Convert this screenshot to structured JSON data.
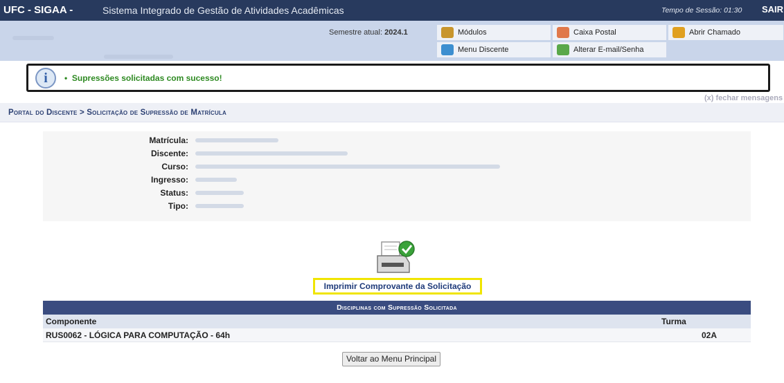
{
  "topbar": {
    "system": "UFC - SIGAA -",
    "system_name": "Sistema Integrado de Gestão de Atividades Acadêmicas",
    "session": "Tempo de Sessão: 01:30",
    "logout": "SAIR"
  },
  "header": {
    "semester_label": "Semestre atual:",
    "semester_value": "2024.1",
    "menu": [
      {
        "label": "Módulos",
        "icon": "modules-icon"
      },
      {
        "label": "Caixa Postal",
        "icon": "mailbox-icon"
      },
      {
        "label": "Abrir Chamado",
        "icon": "ticket-icon"
      },
      {
        "label": "Menu Discente",
        "icon": "student-menu-icon"
      },
      {
        "label": "Alterar E-mail/Senha",
        "icon": "change-password-icon"
      }
    ]
  },
  "message": {
    "bullet": "•",
    "text": "Supressões solicitadas com sucesso!",
    "close": "(x) fechar mensagens"
  },
  "breadcrumb": "Portal do Discente > Solicitação de Supressão de Matrícula",
  "student": {
    "labels": [
      "Matrícula:",
      "Discente:",
      "Curso:",
      "Ingresso:",
      "Status:",
      "Tipo:"
    ]
  },
  "print_link": "Imprimir Comprovante da Solicitação",
  "table": {
    "title": "Disciplinas com Supressão Solicitada",
    "columns": [
      "Componente",
      "Turma"
    ],
    "rows": [
      {
        "componente": "RUS0062 - LÓGICA PARA COMPUTAÇÃO - 64h",
        "turma": "02A"
      }
    ]
  },
  "back_button": "Voltar ao Menu Principal",
  "colors": {
    "topbar": "#283a5e",
    "header_bg": "#c9d5ea",
    "success_text": "#2e8a22",
    "highlight": "#f0e500",
    "table_header": "#3a4c80"
  }
}
